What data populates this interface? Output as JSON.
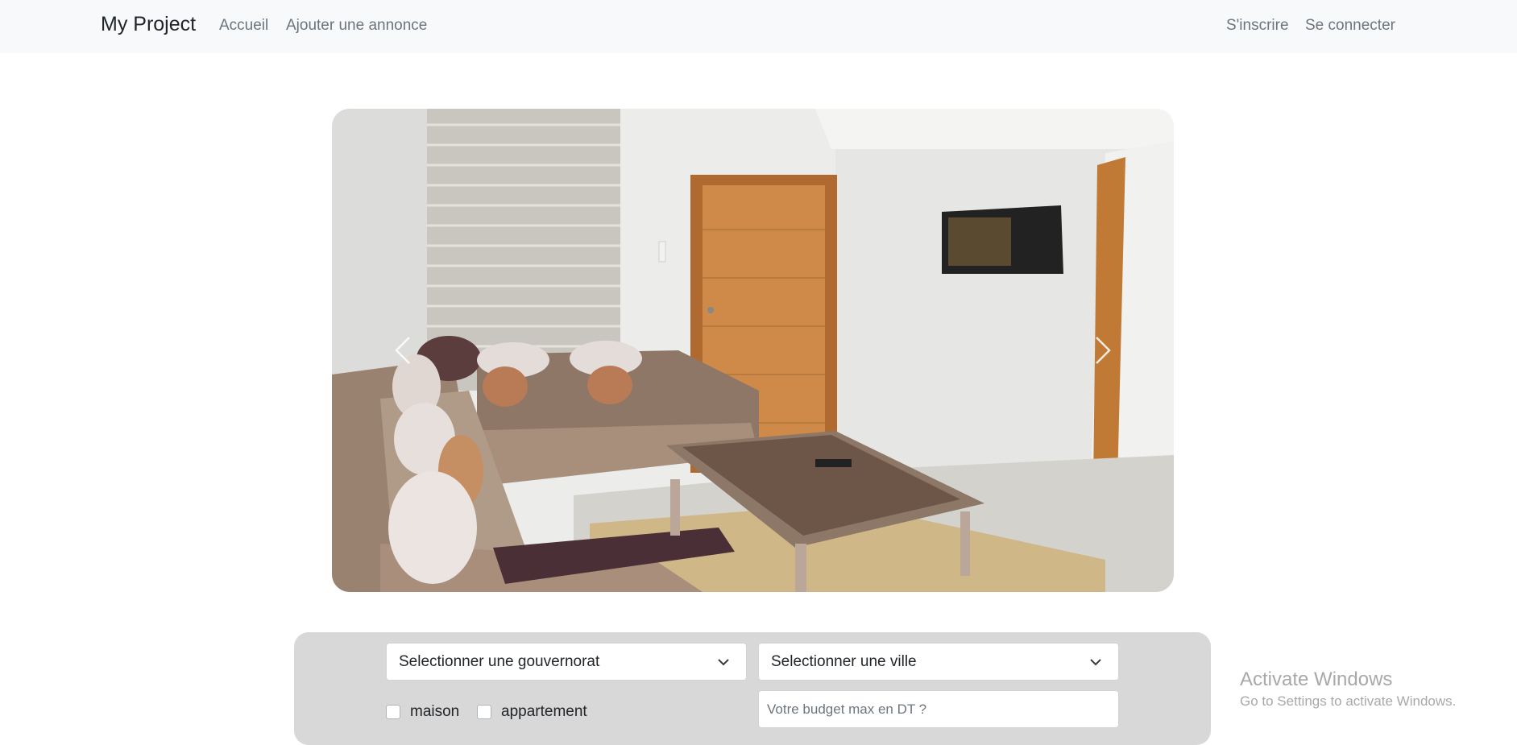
{
  "navbar": {
    "brand": "My Project",
    "links": [
      "Accueil",
      "Ajouter une annonce"
    ],
    "auth_links": [
      "S'inscrire",
      "Se connecter"
    ]
  },
  "carousel": {
    "prev_icon": "chevron-left-icon",
    "next_icon": "chevron-right-icon"
  },
  "search": {
    "gouvernorat_select": "Selectionner une gouvernorat",
    "ville_select": "Selectionner une ville",
    "types": [
      "maison",
      "appartement"
    ],
    "budget_placeholder": "Votre budget max en DT ?"
  },
  "watermark": {
    "title": "Activate Windows",
    "subtitle": "Go to Settings to activate Windows."
  },
  "colors": {
    "navbar_bg": "#f8f9fa",
    "panel_bg": "#d9d8d8",
    "link": "#6c757d",
    "text": "#212529"
  }
}
